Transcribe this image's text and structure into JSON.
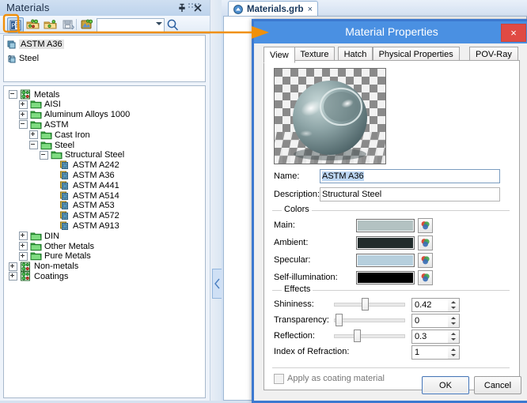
{
  "dock": {
    "title": "Materials",
    "pin_icon": "pin-icon",
    "close_icon": "close-icon",
    "toolbar": {
      "buttons": [
        {
          "name": "material-editor-button",
          "icon": "material-editor-icon",
          "active": true
        },
        {
          "name": "new-material-button",
          "icon": "new-material-icon",
          "active": false
        },
        {
          "name": "open-library-button",
          "icon": "open-library-icon",
          "active": false
        },
        {
          "name": "save-material-button",
          "icon": "save-material-icon",
          "active": false
        },
        {
          "name": "apply-material-button",
          "icon": "apply-material-icon",
          "active": false
        },
        {
          "name": "material-palette-button",
          "icon": "material-palette-icon",
          "active": false
        }
      ],
      "combo_value": "",
      "search_icon": "search-icon"
    },
    "favorites": [
      {
        "label": "ASTM A36",
        "icon": "material-swatch-icon",
        "selected": true
      },
      {
        "label": "Steel",
        "icon": "material-unknown-icon",
        "selected": false
      }
    ],
    "tree": [
      {
        "label": "Metals",
        "depth": 0,
        "icon": "category-icon",
        "state": "expanded"
      },
      {
        "label": "AISI",
        "depth": 1,
        "icon": "folder-icon",
        "state": "collapsed"
      },
      {
        "label": "Aluminum Alloys 1000",
        "depth": 1,
        "icon": "folder-icon",
        "state": "collapsed"
      },
      {
        "label": "ASTM",
        "depth": 1,
        "icon": "folder-icon",
        "state": "expanded"
      },
      {
        "label": "Cast Iron",
        "depth": 2,
        "icon": "folder-icon",
        "state": "collapsed"
      },
      {
        "label": "Steel",
        "depth": 2,
        "icon": "folder-icon",
        "state": "expanded"
      },
      {
        "label": "Structural Steel",
        "depth": 3,
        "icon": "folder-icon",
        "state": "expanded"
      },
      {
        "label": "ASTM A242",
        "depth": 4,
        "icon": "material-swatch-icon",
        "state": "leaf"
      },
      {
        "label": "ASTM A36",
        "depth": 4,
        "icon": "material-swatch-icon",
        "state": "leaf"
      },
      {
        "label": "ASTM A441",
        "depth": 4,
        "icon": "material-swatch-icon",
        "state": "leaf"
      },
      {
        "label": "ASTM A514",
        "depth": 4,
        "icon": "material-swatch-icon",
        "state": "leaf"
      },
      {
        "label": "ASTM A53",
        "depth": 4,
        "icon": "material-swatch-icon",
        "state": "leaf"
      },
      {
        "label": "ASTM A572",
        "depth": 4,
        "icon": "material-swatch-icon",
        "state": "leaf"
      },
      {
        "label": "ASTM A913",
        "depth": 4,
        "icon": "material-swatch-icon",
        "state": "leaf"
      },
      {
        "label": "DIN",
        "depth": 1,
        "icon": "folder-icon",
        "state": "collapsed"
      },
      {
        "label": "Other Metals",
        "depth": 1,
        "icon": "folder-icon",
        "state": "collapsed"
      },
      {
        "label": "Pure Metals",
        "depth": 1,
        "icon": "folder-icon",
        "state": "collapsed"
      },
      {
        "label": "Non-metals",
        "depth": 0,
        "icon": "category-icon",
        "state": "collapsed"
      },
      {
        "label": "Coatings",
        "depth": 0,
        "icon": "category-icon",
        "state": "collapsed"
      }
    ]
  },
  "document": {
    "tab_label": "Materials.grb",
    "tab_icon": "document-icon",
    "tab_close_icon": "close-icon"
  },
  "dialog": {
    "title": "Material Properties",
    "close_label": "×",
    "tabs": [
      {
        "label": "View",
        "selected": true
      },
      {
        "label": "Texture",
        "selected": false
      },
      {
        "label": "Hatch",
        "selected": false
      },
      {
        "label": "Physical Properties",
        "selected": false
      },
      {
        "label": "POV-Ray",
        "selected": false
      }
    ],
    "preview_alt": "material-sphere-preview",
    "fields": {
      "name_label": "Name:",
      "name_value": "ASTM A36",
      "description_label": "Description:",
      "description_value": "Structural Steel"
    },
    "colors_group": "Colors",
    "colors": [
      {
        "label": "Main:",
        "hex": "#b3c2c2"
      },
      {
        "label": "Ambient:",
        "hex": "#212b2b"
      },
      {
        "label": "Specular:",
        "hex": "#b6cfdd"
      },
      {
        "label": "Self-illumination:",
        "hex": "#000000"
      }
    ],
    "effects_group": "Effects",
    "effects": [
      {
        "label": "Shininess:",
        "value": "0.42",
        "slider": true,
        "percent": 42
      },
      {
        "label": "Transparency:",
        "value": "0",
        "slider": true,
        "percent": 2
      },
      {
        "label": "Reflection:",
        "value": "0.3",
        "slider": true,
        "percent": 30
      },
      {
        "label": "Index of Refraction:",
        "value": "1",
        "slider": false,
        "percent": 0
      }
    ],
    "coating_checkbox_label": "Apply as coating material",
    "coating_checked": false,
    "ok_label": "OK",
    "cancel_label": "Cancel"
  },
  "annotation": {
    "accent_hex": "#F0900A",
    "shape": "callout-arrow"
  }
}
